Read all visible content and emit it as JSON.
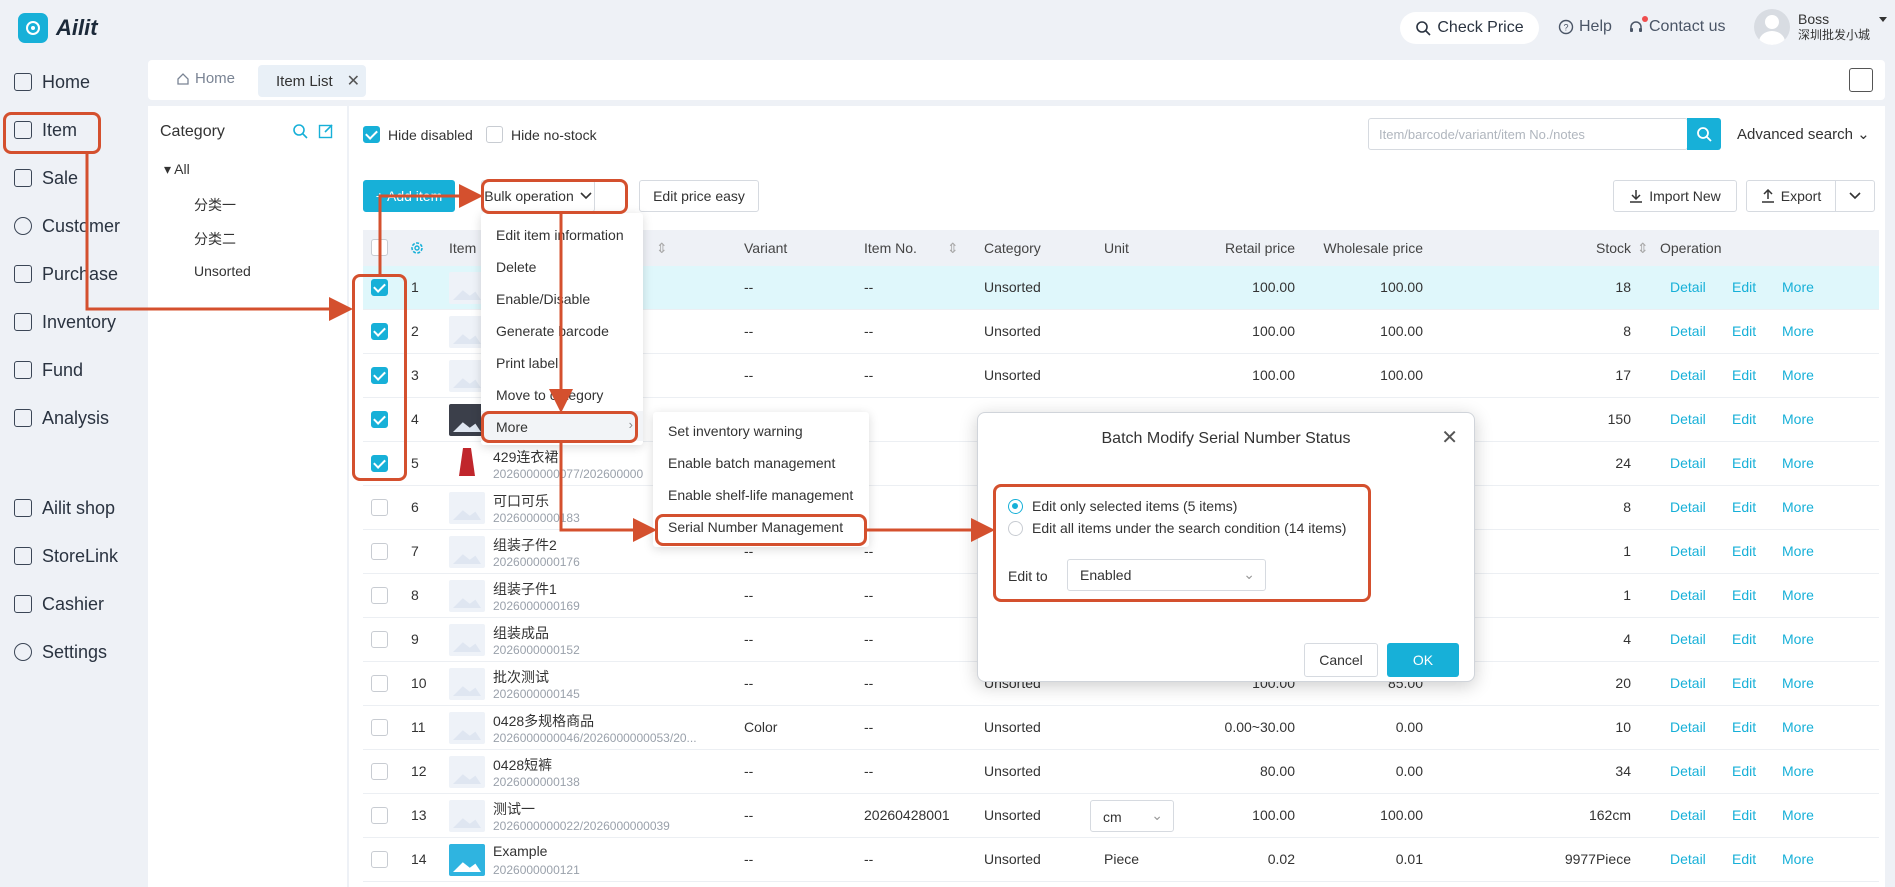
{
  "app": {
    "name": "Ailit"
  },
  "topbar": {
    "check_price": "Check Price",
    "help": "Help",
    "contact": "Contact us",
    "user_name": "Boss",
    "user_org": "深圳批发小城"
  },
  "sidebar": {
    "items": [
      {
        "label": "Home"
      },
      {
        "label": "Item"
      },
      {
        "label": "Sale"
      },
      {
        "label": "Customer"
      },
      {
        "label": "Purchase"
      },
      {
        "label": "Inventory"
      },
      {
        "label": "Fund"
      },
      {
        "label": "Analysis"
      },
      {
        "label": "Ailit shop"
      },
      {
        "label": "StoreLink"
      },
      {
        "label": "Cashier"
      },
      {
        "label": "Settings"
      }
    ]
  },
  "tabs": {
    "home": "Home",
    "item_list": "Item List"
  },
  "category": {
    "title": "Category",
    "all": "All",
    "children": [
      "分类一",
      "分类二",
      "Unsorted"
    ]
  },
  "filters": {
    "hide_disabled": "Hide disabled",
    "hide_no_stock": "Hide no-stock"
  },
  "search": {
    "placeholder": "Item/barcode/variant/item No./notes",
    "advanced": "Advanced search"
  },
  "toolbar": {
    "add_item": "+ Add item",
    "bulk_operation": "Bulk operation",
    "edit_price_easy": "Edit price easy",
    "import_new": "Import New",
    "export": "Export"
  },
  "table": {
    "headers": {
      "item": "Item",
      "variant": "Variant",
      "item_no": "Item No.",
      "category": "Category",
      "unit": "Unit",
      "retail": "Retail price",
      "wholesale": "Wholesale price",
      "stock": "Stock",
      "operation": "Operation"
    },
    "op_detail": "Detail",
    "op_edit": "Edit",
    "op_more": "More",
    "rows": [
      {
        "idx": "1",
        "name": "",
        "code": "",
        "variant": "--",
        "item_no": "--",
        "category": "Unsorted",
        "unit": "",
        "retail": "100.00",
        "wholesale": "100.00",
        "stock": "18"
      },
      {
        "idx": "2",
        "name": "",
        "code": "",
        "variant": "--",
        "item_no": "--",
        "category": "Unsorted",
        "unit": "",
        "retail": "100.00",
        "wholesale": "100.00",
        "stock": "8"
      },
      {
        "idx": "3",
        "name": "",
        "code": "",
        "variant": "--",
        "item_no": "--",
        "category": "Unsorted",
        "unit": "",
        "retail": "100.00",
        "wholesale": "100.00",
        "stock": "17"
      },
      {
        "idx": "4",
        "name": "",
        "code": "",
        "variant": "",
        "item_no": "",
        "category": "分",
        "unit": "",
        "retail": "",
        "wholesale": "",
        "stock": "150"
      },
      {
        "idx": "5",
        "name": "429连衣裙",
        "code": "2026000000077/202600000",
        "variant": "",
        "item_no": "",
        "category": "分",
        "unit": "",
        "retail": "",
        "wholesale": "",
        "stock": "24"
      },
      {
        "idx": "6",
        "name": "可口可乐",
        "code": "2026000000183",
        "variant": "",
        "item_no": "",
        "category": "分",
        "unit": "",
        "retail": "",
        "wholesale": "",
        "stock": "8"
      },
      {
        "idx": "7",
        "name": "组装子件2",
        "code": "2026000000176",
        "variant": "--",
        "item_no": "--",
        "category": "U",
        "unit": "",
        "retail": "",
        "wholesale": "",
        "stock": "1"
      },
      {
        "idx": "8",
        "name": "组装子件1",
        "code": "2026000000169",
        "variant": "--",
        "item_no": "--",
        "category": "U",
        "unit": "",
        "retail": "",
        "wholesale": "",
        "stock": "1"
      },
      {
        "idx": "9",
        "name": "组装成品",
        "code": "2026000000152",
        "variant": "--",
        "item_no": "--",
        "category": "U",
        "unit": "",
        "retail": "",
        "wholesale": "",
        "stock": "4"
      },
      {
        "idx": "10",
        "name": "批次测试",
        "code": "2026000000145",
        "variant": "--",
        "item_no": "--",
        "category": "Unsorted",
        "unit": "",
        "retail": "100.00",
        "wholesale": "85.00",
        "stock": "20"
      },
      {
        "idx": "11",
        "name": "0428多规格商品",
        "code": "2026000000046/2026000000053/20...",
        "variant": "Color",
        "item_no": "--",
        "category": "Unsorted",
        "unit": "",
        "retail": "0.00~30.00",
        "wholesale": "0.00",
        "stock": "10"
      },
      {
        "idx": "12",
        "name": "0428短裤",
        "code": "2026000000138",
        "variant": "--",
        "item_no": "--",
        "category": "Unsorted",
        "unit": "",
        "retail": "80.00",
        "wholesale": "0.00",
        "stock": "34"
      },
      {
        "idx": "13",
        "name": "测试一",
        "code": "2026000000022/2026000000039",
        "variant": "--",
        "item_no": "20260428001",
        "category": "Unsorted",
        "unit": "cm",
        "retail": "100.00",
        "wholesale": "100.00",
        "stock": "162cm"
      },
      {
        "idx": "14",
        "name": "Example",
        "code": "2026000000121",
        "variant": "--",
        "item_no": "--",
        "category": "Unsorted",
        "unit": "Piece",
        "retail": "0.02",
        "wholesale": "0.01",
        "stock": "9977Piece"
      }
    ]
  },
  "bulk_menu": {
    "items": [
      "Edit item information",
      "Delete",
      "Enable/Disable",
      "Generate barcode",
      "Print label",
      "Move to category",
      "More"
    ]
  },
  "more_menu": {
    "items": [
      "Set inventory warning",
      "Enable batch management",
      "Enable shelf-life management",
      "Serial Number Management"
    ]
  },
  "dialog": {
    "title": "Batch Modify Serial Number Status",
    "option_selected": "Edit only selected items (5 items)",
    "option_all": "Edit all items under the search condition (14 items)",
    "edit_to_label": "Edit to",
    "edit_to_value": "Enabled",
    "cancel": "Cancel",
    "ok": "OK"
  },
  "colors": {
    "accent": "#17b0d8",
    "annotation": "#d4502e",
    "highlight_row": "#dff7fb"
  }
}
